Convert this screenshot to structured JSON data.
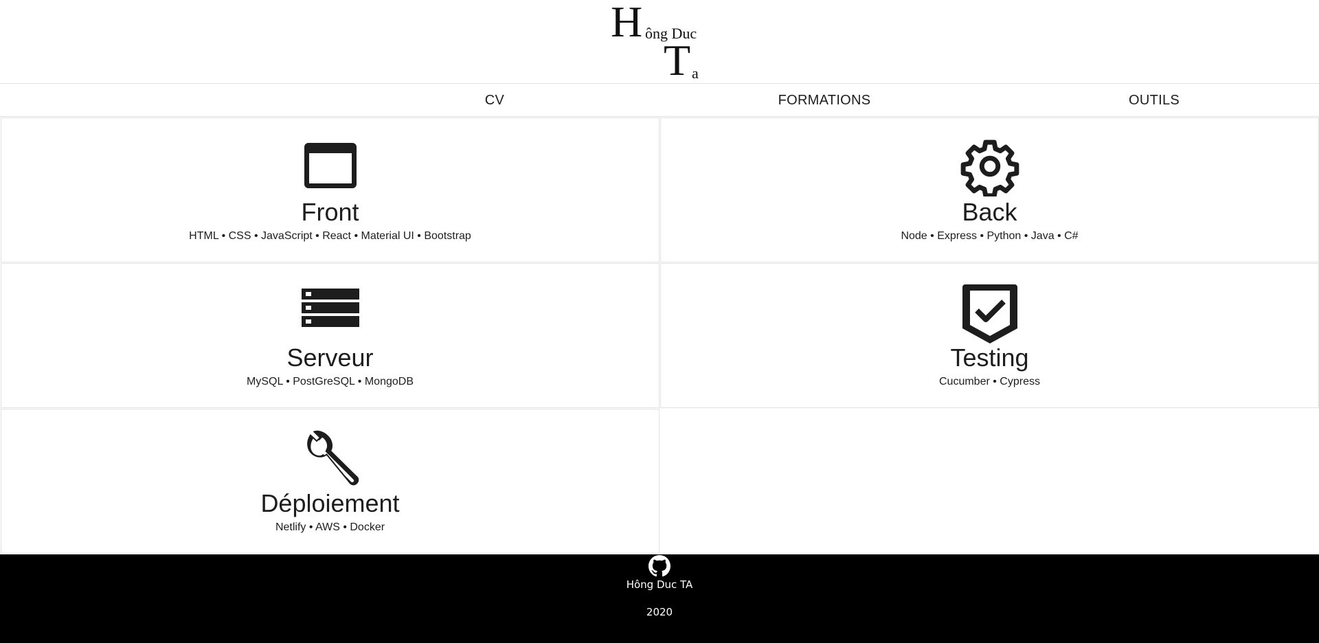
{
  "logo": {
    "initial_first": "H",
    "first_rest": "ông Duc",
    "initial_last": "T",
    "last_rest": "a"
  },
  "nav": {
    "items": [
      {
        "label": "CV"
      },
      {
        "label": "FORMATIONS"
      },
      {
        "label": "OUTILS"
      }
    ]
  },
  "cards": [
    {
      "title": "Front",
      "subtitle": "HTML • CSS • JavaScript • React • Material UI • Bootstrap",
      "icon": "browser-window-icon"
    },
    {
      "title": "Back",
      "subtitle": "Node • Express • Python • Java • C#",
      "icon": "gear-icon"
    },
    {
      "title": "Serveur",
      "subtitle": "MySQL • PostGreSQL • MongoDB",
      "icon": "server-stack-icon"
    },
    {
      "title": "Testing",
      "subtitle": "Cucumber • Cypress",
      "icon": "shield-check-icon"
    },
    {
      "title": "Déploiement",
      "subtitle": "Netlify • AWS • Docker",
      "icon": "wrench-icon"
    }
  ],
  "footer": {
    "icon": "github-icon",
    "name": "Hông Duc TA",
    "year": "2020"
  },
  "colors": {
    "text": "#1d1d1d",
    "border": "#e2e2e2",
    "footer_bg": "#000000",
    "footer_text": "#ffffff"
  }
}
